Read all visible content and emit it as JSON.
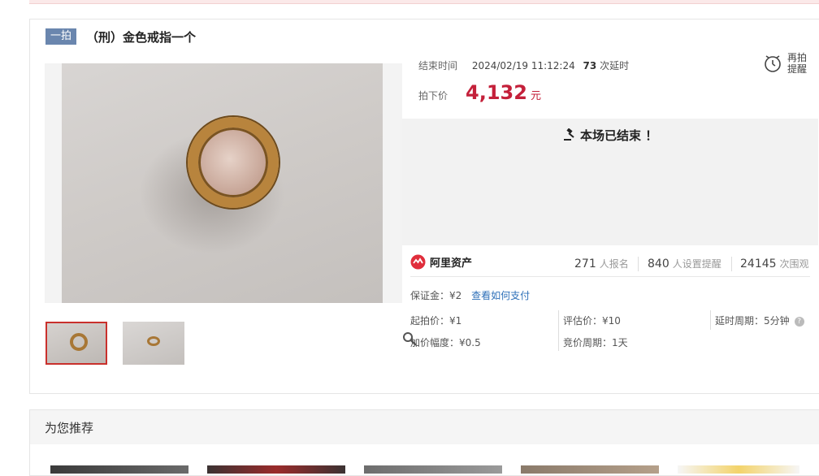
{
  "item": {
    "round_badge": "一拍",
    "title": "（刑）金色戒指一个"
  },
  "auction": {
    "end_label": "结束时间",
    "end_time": "2024/02/19 11:12:24",
    "delay_count": "73",
    "delay_suffix": "次延时",
    "final_label": "拍下价",
    "final_price": "4,132",
    "currency_unit": "元",
    "remind_label": "再拍提醒",
    "ended_message": "本场已结束 ！"
  },
  "platform": {
    "name": "阿里资产"
  },
  "stats": {
    "signups": "271",
    "signups_unit": "人报名",
    "reminders": "840",
    "reminders_unit": "人设置提醒",
    "views": "24145",
    "views_unit": "次围观"
  },
  "deposit": {
    "text": "保证金：¥2",
    "link": "查看如何支付"
  },
  "params": {
    "start_price": "起拍价：¥1",
    "increment": "加价幅度：¥0.5",
    "appraisal": "评估价：¥10",
    "bid_period": "竞价周期：1天",
    "delay_period": "延时周期：5分钟",
    "help": "?"
  },
  "recommend": {
    "title": "为您推荐"
  },
  "colors": {
    "price_red": "#c4203a",
    "link_blue": "#2d6fb8",
    "badge_blue": "#6a86ae",
    "thumb_active": "#c9302c"
  },
  "icons": {
    "zoom": "magnifier-icon",
    "remind": "alarm-clock-icon",
    "ended": "gavel-icon",
    "platform": "ali-asset-logo-icon",
    "help": "question-circle-icon"
  }
}
